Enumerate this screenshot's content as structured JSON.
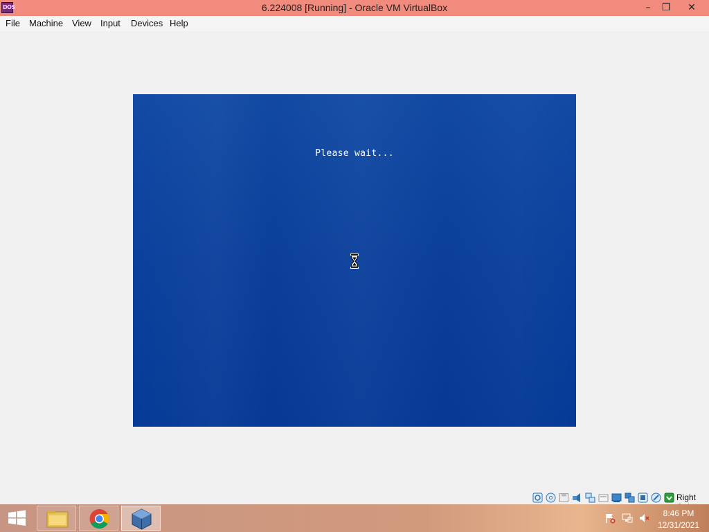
{
  "window": {
    "title": "6.224008 [Running] - Oracle VM VirtualBox",
    "app_icon_text": "DOS",
    "minimize_glyph": "–",
    "maximize_glyph": "❐",
    "close_glyph": "✕"
  },
  "menu": {
    "items": [
      "File",
      "Machine",
      "View",
      "Input",
      "Devices",
      "Help"
    ]
  },
  "vm": {
    "message": "Please wait...",
    "background_color": "#0b409c"
  },
  "statusbar": {
    "icons": [
      "hard-disk-icon",
      "optical-drive-icon",
      "floppy-icon",
      "audio-icon",
      "network-icon",
      "usb-icon",
      "shared-folders-icon",
      "display-icon",
      "video-capture-icon",
      "cpu-icon",
      "mouse-integration-icon",
      "host-key-icon"
    ],
    "host_key": "Right Ctrl"
  },
  "taskbar": {
    "apps": [
      "file-explorer",
      "google-chrome",
      "virtualbox"
    ],
    "active_app": "virtualbox",
    "tray_icons": [
      "action-center-flag-icon",
      "network-icon",
      "volume-muted-icon"
    ],
    "clock_time": "8:46 PM",
    "clock_date": "12/31/2021"
  }
}
